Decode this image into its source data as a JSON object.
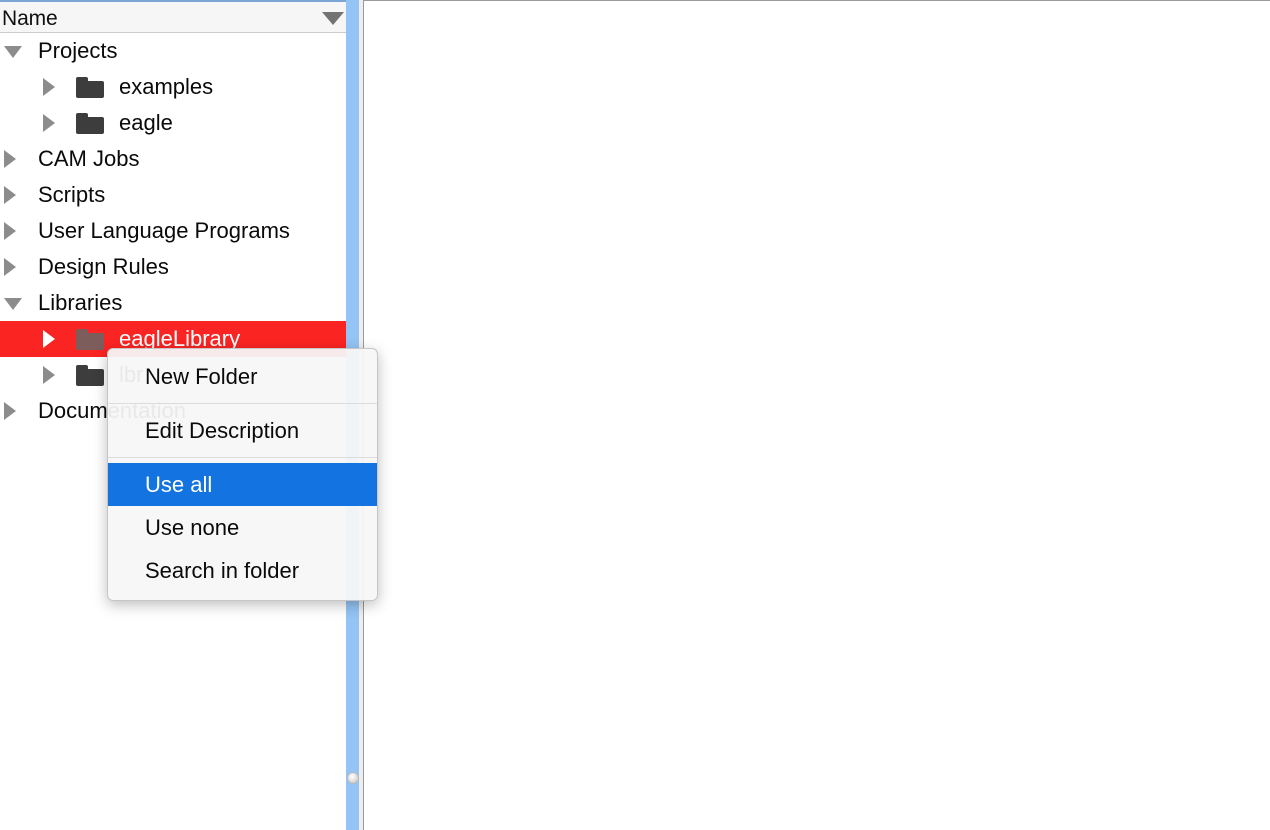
{
  "tree": {
    "header": {
      "column_label": "Name",
      "sort_icon": "triangle-down-icon"
    },
    "items": [
      {
        "label": "Projects",
        "state": "open",
        "has_folder_icon": false,
        "indent": 0,
        "selected": false
      },
      {
        "label": "examples",
        "state": "closed",
        "has_folder_icon": true,
        "indent": 1,
        "selected": false
      },
      {
        "label": "eagle",
        "state": "closed",
        "has_folder_icon": true,
        "indent": 1,
        "selected": false
      },
      {
        "label": "CAM Jobs",
        "state": "closed",
        "has_folder_icon": false,
        "indent": 0,
        "selected": false
      },
      {
        "label": "Scripts",
        "state": "closed",
        "has_folder_icon": false,
        "indent": 0,
        "selected": false
      },
      {
        "label": "User Language Programs",
        "state": "closed",
        "has_folder_icon": false,
        "indent": 0,
        "selected": false
      },
      {
        "label": "Design Rules",
        "state": "closed",
        "has_folder_icon": false,
        "indent": 0,
        "selected": false
      },
      {
        "label": "Libraries",
        "state": "open",
        "has_folder_icon": false,
        "indent": 0,
        "selected": false
      },
      {
        "label": "eagleLibrary",
        "state": "closed",
        "has_folder_icon": true,
        "indent": 1,
        "selected": true
      },
      {
        "label": "lbr",
        "state": "closed",
        "has_folder_icon": true,
        "indent": 1,
        "selected": false
      },
      {
        "label": "Documentation",
        "state": "closed",
        "has_folder_icon": false,
        "indent": 0,
        "selected": false
      }
    ]
  },
  "context_menu": {
    "items": [
      {
        "label": "New Folder",
        "highlight": false,
        "separator_after": true
      },
      {
        "label": "Edit Description",
        "highlight": false,
        "separator_after": true
      },
      {
        "label": "Use all",
        "highlight": true,
        "separator_after": false
      },
      {
        "label": "Use none",
        "highlight": false,
        "separator_after": false
      },
      {
        "label": "Search in folder",
        "highlight": false,
        "separator_after": false
      }
    ]
  },
  "colors": {
    "selection_red": "#fa2423",
    "menu_highlight_blue": "#1373e0",
    "scrollbar_blue": "#93c4f5",
    "folder_icon": "#3d3d3d",
    "header_background": "#f6f6f6"
  },
  "scrollbar": {
    "orientation": "vertical",
    "grip_icon": "resize-grip-icon"
  }
}
